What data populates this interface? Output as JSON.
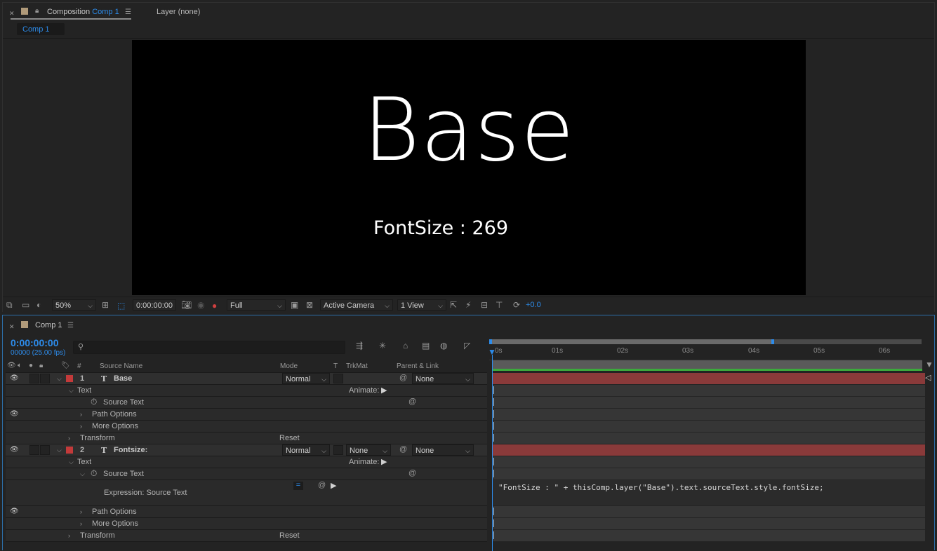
{
  "comp_panel": {
    "tab_prefix": "Composition",
    "tab_name": "Comp 1",
    "layer_tab": "Layer (none)",
    "sub_tab": "Comp 1"
  },
  "viewer": {
    "main_text": "Base",
    "sub_text": "FontSize : 269"
  },
  "viewer_toolbar": {
    "zoom": "50%",
    "timecode": "0:00:00:00",
    "resolution": "Full",
    "camera": "Active Camera",
    "views": "1 View",
    "exposure": "+0.0"
  },
  "timeline": {
    "tab_name": "Comp 1",
    "current_time": "0:00:00:00",
    "frame_info": "00000 (25.00 fps)",
    "search_placeholder": "",
    "columns": {
      "number": "#",
      "source_name": "Source Name",
      "mode": "Mode",
      "t": "T",
      "trkmat": "TrkMat",
      "parent": "Parent & Link"
    },
    "ruler": [
      "0s",
      "01s",
      "02s",
      "03s",
      "04s",
      "05s",
      "06s"
    ],
    "work_area_end_fraction": 0.66,
    "layers": [
      {
        "number": "1",
        "name": "Base",
        "mode": "Normal",
        "trkmat": "",
        "parent": "None",
        "color": "#c33a3a",
        "props": {
          "text": "Text",
          "animate": "Animate:",
          "source_text": "Source Text",
          "path_options": "Path Options",
          "more_options": "More Options",
          "transform": "Transform",
          "reset": "Reset"
        }
      },
      {
        "number": "2",
        "name": "Fontsize:",
        "mode": "Normal",
        "trkmat": "None",
        "parent": "None",
        "color": "#c33a3a",
        "props": {
          "text": "Text",
          "animate": "Animate:",
          "source_text": "Source Text",
          "expression_label": "Expression: Source Text",
          "expression": "\"FontSize : \" + thisComp.layer(\"Base\").text.sourceText.style.fontSize;",
          "path_options": "Path Options",
          "more_options": "More Options",
          "transform": "Transform",
          "reset": "Reset"
        }
      }
    ]
  },
  "icons": [
    "close-icon",
    "lock-icon",
    "panel-menu-icon",
    "eye-icon",
    "audio-icon",
    "solo-icon",
    "lock-column-icon",
    "label-icon",
    "text-layer-icon",
    "stopwatch-icon",
    "pickwhip-icon",
    "play-icon",
    "search-icon",
    "camera-icon",
    "snapshot-icon",
    "color-channels-icon",
    "fast-preview-icon",
    "reset-exposure-icon",
    "graph-editor-icon",
    "twirl-icon"
  ]
}
